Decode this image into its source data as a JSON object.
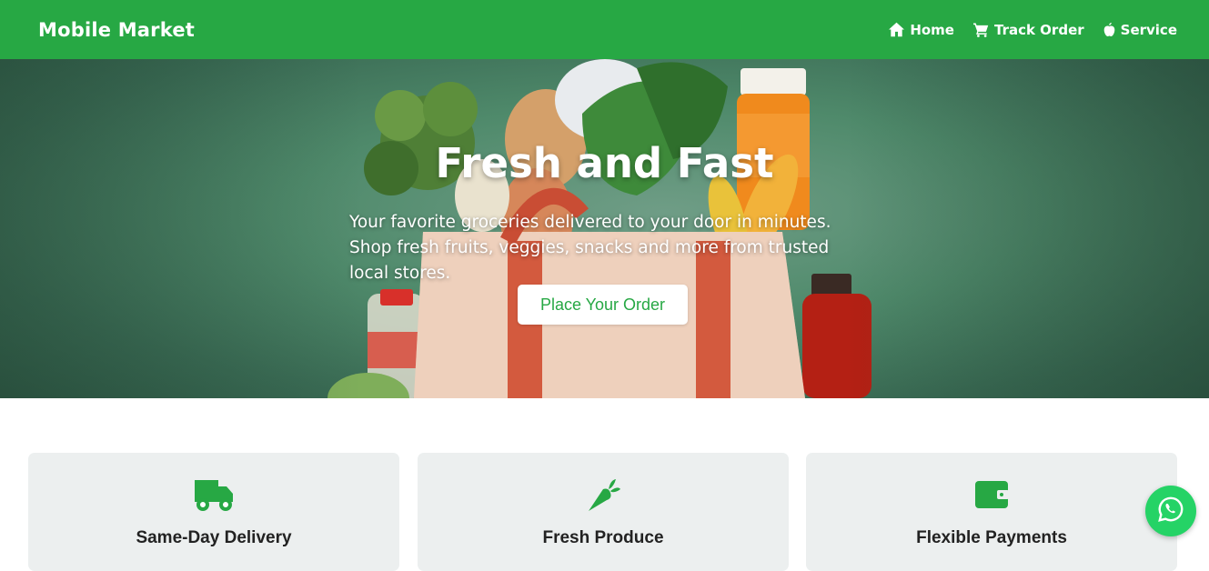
{
  "navbar": {
    "brand": "Mobile Market",
    "links": [
      {
        "label": "Home",
        "icon": "home-icon"
      },
      {
        "label": "Track Order",
        "icon": "cart-icon"
      },
      {
        "label": "Service",
        "icon": "apple-icon"
      }
    ]
  },
  "hero": {
    "title": "Fresh and Fast",
    "subtitle": "Your favorite groceries delivered to your door in minutes. Shop fresh fruits, veggies, snacks and more from trusted local stores.",
    "cta_label": "Place Your Order"
  },
  "features": [
    {
      "title": "Same-Day Delivery",
      "icon": "truck-icon"
    },
    {
      "title": "Fresh Produce",
      "icon": "carrot-icon"
    },
    {
      "title": "Flexible Payments",
      "icon": "wallet-icon"
    }
  ],
  "floating": {
    "icon": "whatsapp-icon"
  },
  "colors": {
    "brand_green": "#27a844",
    "card_bg": "#ecefef",
    "whatsapp_green": "#25d366",
    "text_dark": "#222222"
  }
}
